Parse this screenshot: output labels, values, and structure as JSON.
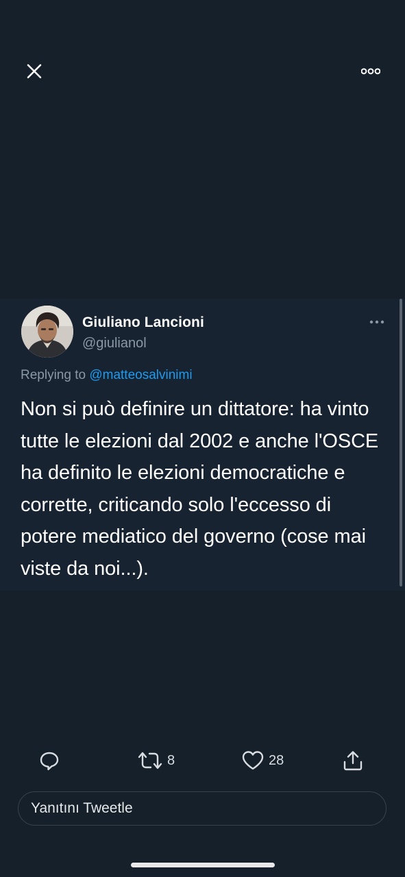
{
  "header": {
    "close_icon": "close-icon",
    "more_icon": "more-horizontal-icon"
  },
  "tweet": {
    "display_name": "Giuliano Lancioni",
    "handle": "@giulianol",
    "replying_prefix": "Replying to",
    "replying_to": "@matteosalvinimi",
    "text": "Non si può definire un dittatore: ha vinto tutte le elezioni dal 2002 e anche l'OSCE ha definito le elezioni democratiche e corrette, criticando solo l'eccesso di potere mediatico del governo (cose mai viste da noi...).",
    "more_icon": "more-horizontal-icon"
  },
  "actions": {
    "reply_icon": "reply-icon",
    "retweet_icon": "retweet-icon",
    "retweet_count": "8",
    "like_icon": "heart-icon",
    "like_count": "28",
    "share_icon": "share-icon"
  },
  "reply_box": {
    "placeholder": "Yanıtını Tweetle"
  },
  "colors": {
    "background": "#15202b",
    "card": "#182331",
    "accent": "#1d9bf0",
    "secondary_text": "#8b98a5"
  }
}
